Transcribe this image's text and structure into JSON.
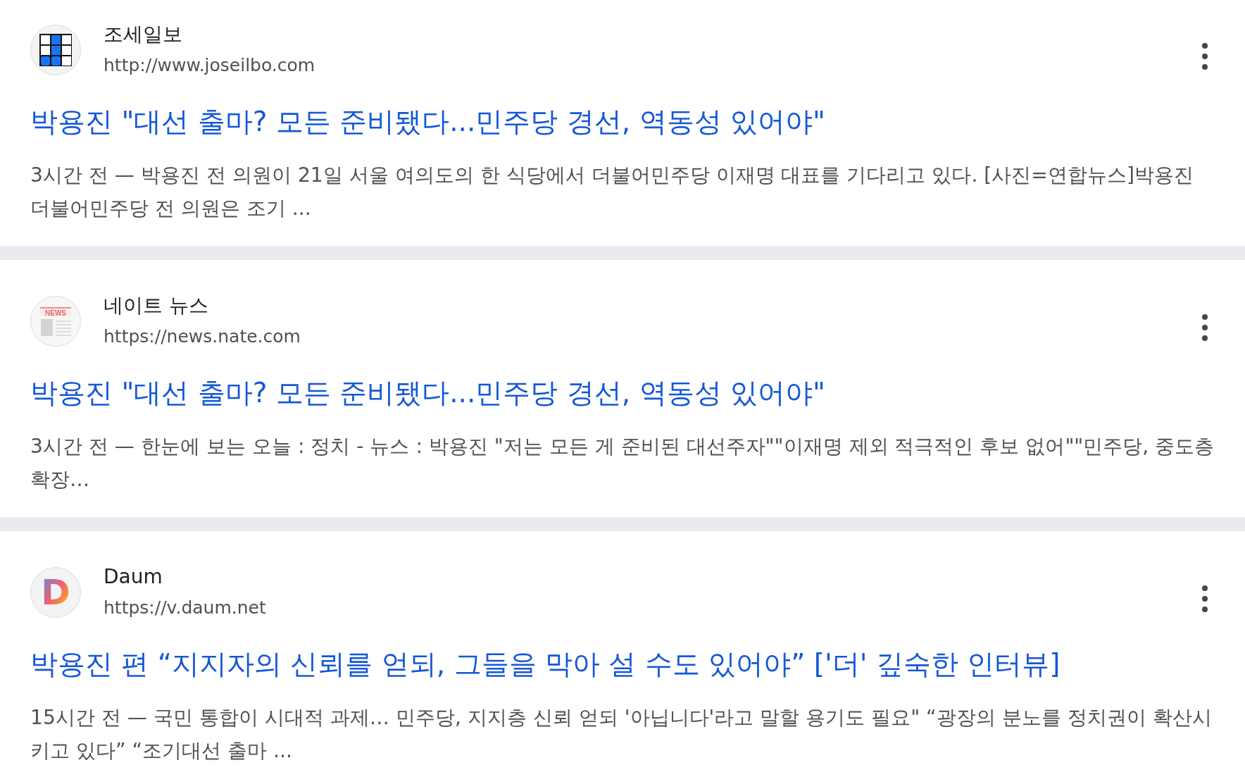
{
  "results": [
    {
      "favicon": {
        "kind": "grid"
      },
      "site_name": "조세일보",
      "url": "http://www.joseilbo.com",
      "title": "박용진 \"대선 출마? 모든 준비됐다...민주당 경선, 역동성 있어야\"",
      "snippet": "3시간 전 — 박용진 전 의원이 21일 서울 여의도의 한 식당에서 더불어민주당 이재명 대표를 기다리고 있다. [사진=연합뉴스]박용진 더불어민주당 전 의원은 조기 ..."
    },
    {
      "favicon": {
        "kind": "news",
        "text": "NEWS"
      },
      "site_name": "네이트 뉴스",
      "url": "https://news.nate.com",
      "title": "박용진 \"대선 출마? 모든 준비됐다...민주당 경선, 역동성 있어야\"",
      "snippet": "3시간 전 — 한눈에 보는 오늘 : 정치 - 뉴스 : 박용진 \"저는 모든 게 준비된 대선주자\"\"이재명 제외 적극적인 후보 없어\"\"민주당, 중도층 확장…"
    },
    {
      "favicon": {
        "kind": "letter",
        "text": "D"
      },
      "site_name": "Daum",
      "url": "https://v.daum.net",
      "title": "박용진 편 “지지자의 신뢰를 얻되, 그들을 막아 설 수도 있어야” ['더' 깊숙한 인터뷰]",
      "snippet": "15시간 전 — 국민 통합이 시대적 과제… 민주당, 지지층 신뢰 얻되 '아닙니다'라고 말할 용기도 필요\" “광장의 분노를 정치권이 확산시키고 있다” “조기대선 출마 ..."
    }
  ]
}
